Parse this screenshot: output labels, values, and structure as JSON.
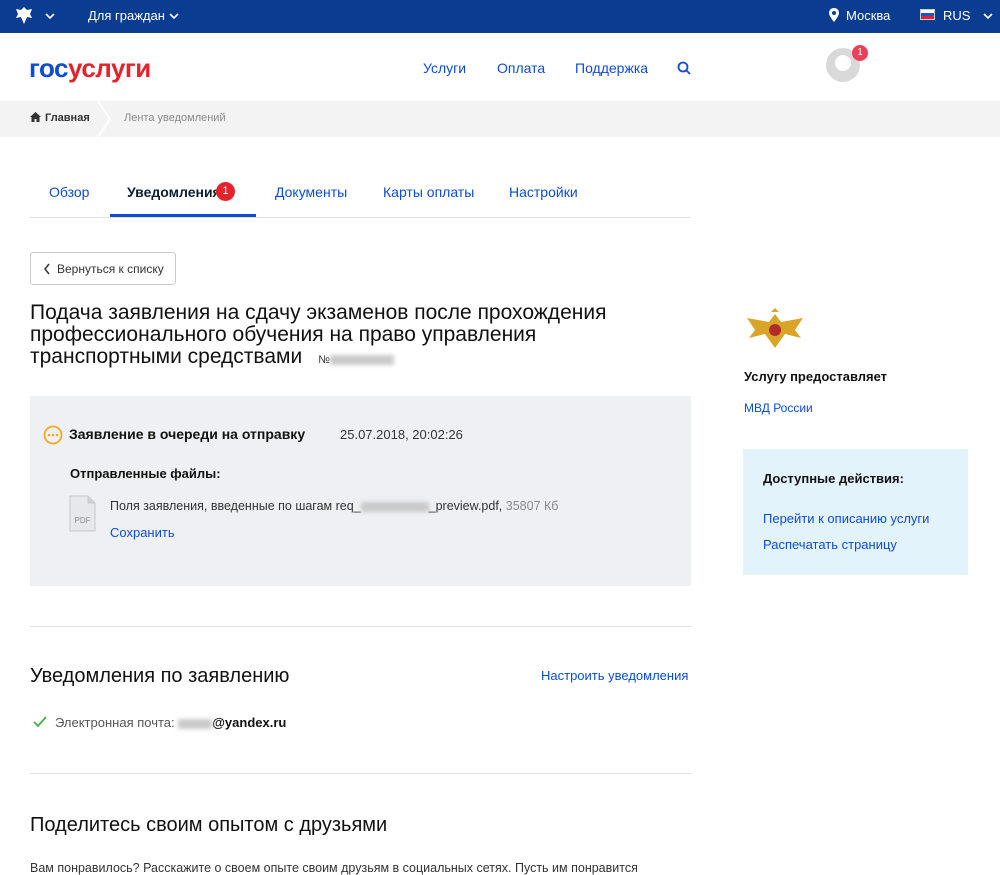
{
  "topbar": {
    "for_citizens": "Для граждан",
    "city": "Москва",
    "language": "RUS"
  },
  "header": {
    "logo_part1": "гос",
    "logo_part2": "услуги",
    "nav": [
      "Услуги",
      "Оплата",
      "Поддержка"
    ],
    "avatar_badge": "1"
  },
  "breadcrumb": {
    "home": "Главная",
    "current": "Лента уведомлений"
  },
  "tabs": [
    {
      "label": "Обзор"
    },
    {
      "label": "Уведомления",
      "badge": "1"
    },
    {
      "label": "Документы"
    },
    {
      "label": "Карты оплаты"
    },
    {
      "label": "Настройки"
    }
  ],
  "back_button": "Вернуться к списку",
  "application": {
    "title": "Подача заявления на сдачу экзаменов после прохождения профессионального обучения на право управления транспортными средствами",
    "number_prefix": "№",
    "status": "Заявление в очереди на отправку",
    "status_date": "25.07.2018, 20:02:26",
    "files_label": "Отправленные файлы:",
    "file": {
      "icon_text": "PDF",
      "name_prefix": "Поля заявления, введенные по шагам req_",
      "name_suffix": "_preview.pdf,",
      "size": "35807 Кб",
      "save": "Сохранить"
    }
  },
  "notifications": {
    "title": "Уведомления по заявлению",
    "settings_link": "Настроить уведомления",
    "email_label": "Электронная почта:",
    "email_domain": "@yandex.ru"
  },
  "share": {
    "title": "Поделитесь своим опытом с друзьями",
    "text": "Вам понравилось? Расскажите о своем опыте своим друзьям в социальных сетях. Пусть им понравится"
  },
  "aside": {
    "provides_label": "Услугу предоставляет",
    "provider": "МВД России",
    "actions_title": "Доступные действия:",
    "actions": [
      "Перейти к описанию услуги",
      "Распечатать страницу"
    ]
  },
  "colors": {
    "topbar": "#0a3d91",
    "link": "#0d4cd3",
    "brand_red": "#e3222b",
    "status_orange": "#f5a623"
  }
}
